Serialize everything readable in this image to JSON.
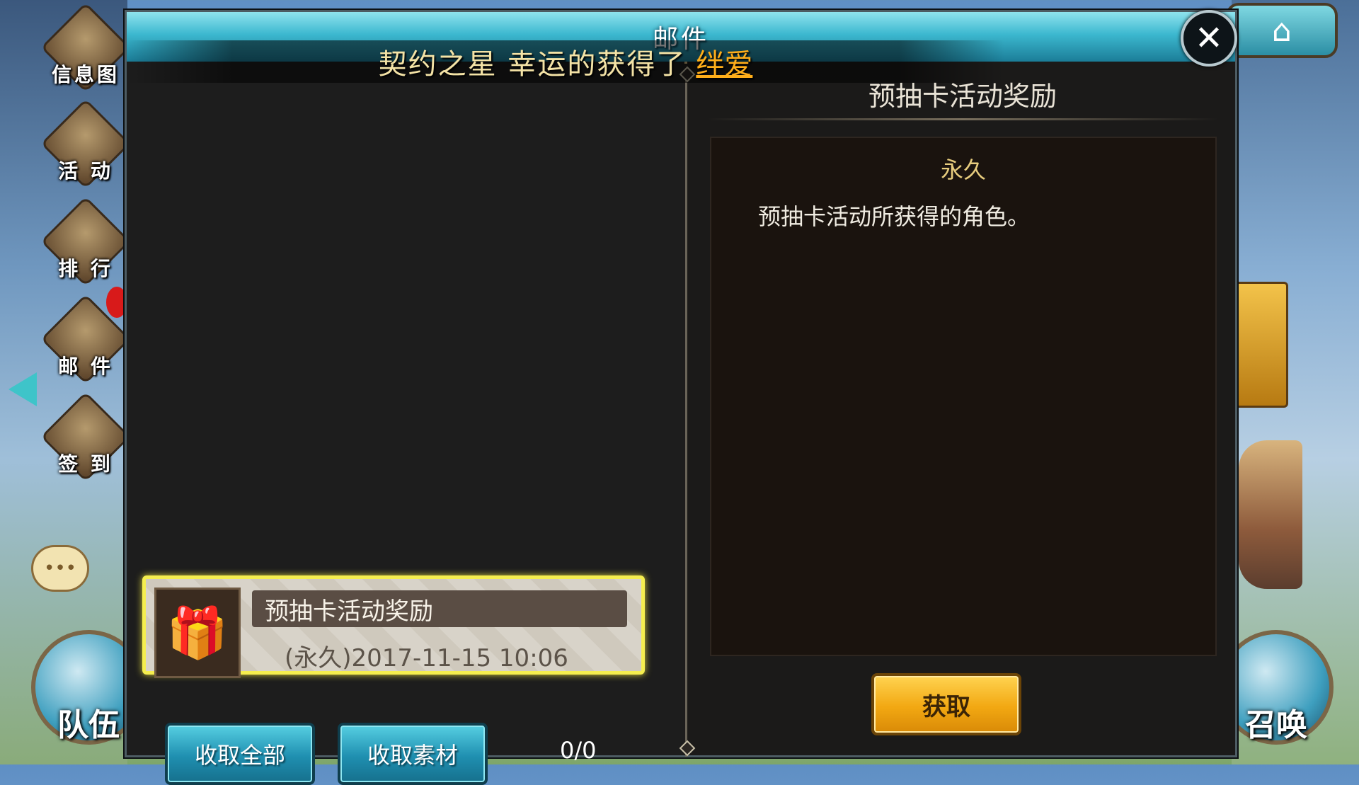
{
  "sidebar": {
    "items": [
      {
        "label": "信息图",
        "icon": "helmet-icon"
      },
      {
        "label": "活 动",
        "icon": "egg-icon"
      },
      {
        "label": "排 行",
        "icon": "trophy-icon"
      },
      {
        "label": "邮 件",
        "icon": "envelope-icon"
      },
      {
        "label": "签 到",
        "icon": "calendar-icon"
      }
    ]
  },
  "bottom_left": {
    "label": "队伍"
  },
  "bottom_right": {
    "label": "召唤"
  },
  "dialog": {
    "title": "邮件",
    "close_glyph": "✕"
  },
  "announcement": {
    "text": "契约之星 幸运的获得了",
    "highlight": "绊爱"
  },
  "mail_list": [
    {
      "title": "预抽卡活动奖励",
      "date": "(永久)2017-11-15  10:06",
      "icon": "gift-icon"
    }
  ],
  "actions": {
    "collect_all": "收取全部",
    "collect_materials": "收取素材",
    "counter": "0/0"
  },
  "detail": {
    "title": "预抽卡活动奖励",
    "tag": "永久",
    "body": "预抽卡活动所获得的角色。",
    "claim": "获取"
  },
  "colors": {
    "accent_teal": "#1f8fb0",
    "accent_gold": "#f2a812",
    "highlight": "#ffae1a",
    "selected_border": "#f5ee4f"
  }
}
